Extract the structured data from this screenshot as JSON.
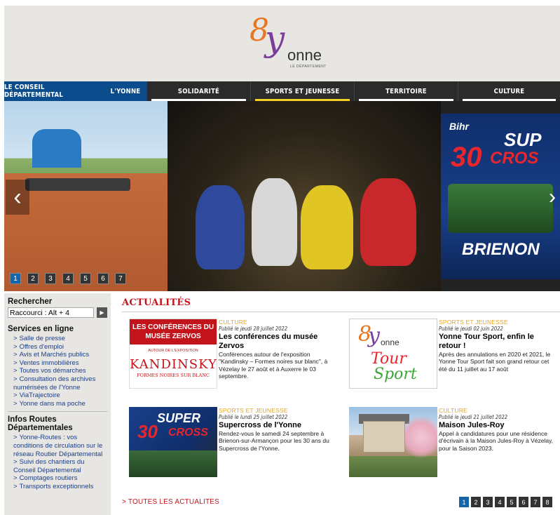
{
  "header": {
    "logo_eight": "8",
    "logo_y": "y",
    "logo_name": "onne",
    "logo_subtitle": "LE DÉPARTEMENT"
  },
  "nav": {
    "items": [
      {
        "label": "LE CONSEIL DÉPARTEMENTAL"
      },
      {
        "label": "L'YONNE"
      },
      {
        "label": "SOLIDARITÉ"
      },
      {
        "label": "SPORTS ET JEUNESSE"
      },
      {
        "label": "TERRITOIRE"
      },
      {
        "label": "CULTURE"
      }
    ],
    "active_underline_color": "#f2d024"
  },
  "slider": {
    "poster_brand": "Bihr",
    "poster_super": "SUP",
    "poster_30": "30",
    "poster_cross": "CROS",
    "poster_brienon": "BRIENON",
    "prev_arrow": "‹",
    "next_arrow": "›",
    "pages": [
      "1",
      "2",
      "3",
      "4",
      "5",
      "6",
      "7"
    ],
    "active_page": "1"
  },
  "sidebar": {
    "search_heading": "Rechercher",
    "search_value": "Raccourci : Alt + 4",
    "search_button": "▶",
    "services_heading": "Services en ligne",
    "services": [
      "Salle de presse",
      "Offres d'emploi",
      "Avis et Marchés publics",
      "Ventes immobilières",
      "Toutes vos démarches",
      "Consultation des archives numérisées de l'Yonne",
      "ViaTrajectoire",
      "Yonne dans ma poche"
    ],
    "infos_heading": "Infos Routes Départementales",
    "infos": [
      "Yonne-Routes : vos conditions de circulation sur le réseau Routier Départemental",
      "Suivi des chantiers du Conseil Départemental",
      "Comptages routiers",
      "Transports exceptionnels"
    ],
    "marker": ">"
  },
  "news": {
    "title": "ACTUALITÉS",
    "cards": [
      {
        "category": "CULTURE",
        "date": "Publié le jeudi 28 juillet 2022",
        "title": "Les conférences du musée Zervos",
        "desc": "Conférences autour de l'exposition \"Kandinsky – Formes noires sur blanc\", à Vézelay le 27 août et à Auxerre le 03 septembre.",
        "thumb_top": "LES CONFÉRENCES DU MUSÉE ZERVOS",
        "thumb_sub": "AUTOUR DE L'EXPOSITION",
        "thumb_big": "KANDINSKY",
        "thumb_small": "FORMES NOIRES SUR BLANC"
      },
      {
        "category": "SPORTS ET JEUNESSE",
        "date": "Publié le jeudi 02 juin 2022",
        "title": "Yonne Tour Sport, enfin le retour !",
        "desc": "Après des annulations en 2020 et 2021, le Yonne Tour Sport fait son grand retour cet été du 11 juillet au 17 août",
        "thumb_eight": "8",
        "thumb_y": "y",
        "thumb_name": "onne",
        "thumb_tour": "Tour",
        "thumb_sport": "Sport"
      },
      {
        "category": "SPORTS ET JEUNESSE",
        "date": "Publié le lundi 25 juillet 2022",
        "title": "Supercross de l'Yonne",
        "desc": "Rendez-vous le samedi 24 septembre à Brienon-sur-Armançon pour les 30 ans du Supercross de l'Yonne.",
        "thumb_super": "SUPER",
        "thumb_30": "30",
        "thumb_cross": "CROSS"
      },
      {
        "category": "CULTURE",
        "date": "Publié le jeudi 21 juillet 2022",
        "title": "Maison Jules-Roy",
        "desc": "Appel à candidatures pour une résidence d'écrivain à la Maison Jules-Roy à Vézelay, pour la Saison 2023."
      }
    ],
    "all_link": "> TOUTES LES ACTUALITES",
    "pages": [
      "1",
      "2",
      "3",
      "4",
      "5",
      "6",
      "7",
      "8"
    ],
    "active_page": "1"
  }
}
